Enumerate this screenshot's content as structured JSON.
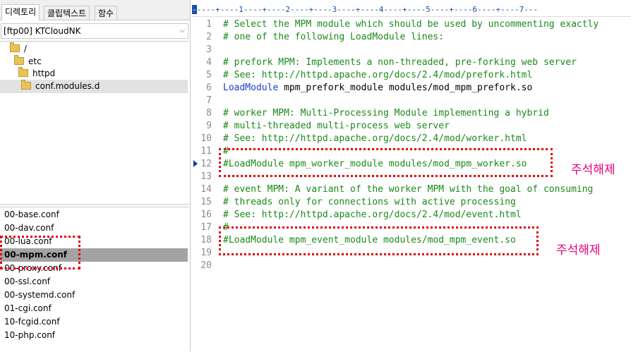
{
  "tabs": [
    "디렉토리",
    "클립텍스트",
    "함수"
  ],
  "site_select": "[ftp00] KTCloudNK",
  "tree": [
    "/",
    "etc",
    "httpd",
    "conf.modules.d"
  ],
  "files": [
    "00-base.conf",
    "00-dav.conf",
    "00-lua.conf",
    "00-mpm.conf",
    "00-proxy.conf",
    "00-ssl.conf",
    "00-systemd.conf",
    "01-cgi.conf",
    "10-fcgid.conf",
    "10-php.conf"
  ],
  "selected_file": "00-mpm.conf",
  "ruler_text": "----+----1----+----2----+----3----+----4----+----5----+----6----+----7---",
  "lines": [
    {
      "n": "1",
      "type": "comment",
      "text": "# Select the MPM module which should be used by uncommenting exactly"
    },
    {
      "n": "2",
      "type": "comment",
      "text": "# one of the following LoadModule lines:"
    },
    {
      "n": "3",
      "type": "blank",
      "text": ""
    },
    {
      "n": "4",
      "type": "comment",
      "text": "# prefork MPM: Implements a non-threaded, pre-forking web server"
    },
    {
      "n": "5",
      "type": "comment",
      "text": "# See: http://httpd.apache.org/docs/2.4/mod/prefork.html"
    },
    {
      "n": "6",
      "type": "directive",
      "kw": "LoadModule",
      "text": " mpm_prefork_module modules/mod_mpm_prefork.so"
    },
    {
      "n": "7",
      "type": "blank",
      "text": ""
    },
    {
      "n": "8",
      "type": "comment",
      "text": "# worker MPM: Multi-Processing Module implementing a hybrid"
    },
    {
      "n": "9",
      "type": "comment",
      "text": "# multi-threaded multi-process web server"
    },
    {
      "n": "10",
      "type": "comment",
      "text": "# See: http://httpd.apache.org/docs/2.4/mod/worker.html"
    },
    {
      "n": "11",
      "type": "comment",
      "text": "#"
    },
    {
      "n": "12",
      "type": "comment",
      "text": "#LoadModule mpm_worker_module modules/mod_mpm_worker.so"
    },
    {
      "n": "13",
      "type": "blank",
      "text": ""
    },
    {
      "n": "14",
      "type": "comment",
      "text": "# event MPM: A variant of the worker MPM with the goal of consuming"
    },
    {
      "n": "15",
      "type": "comment",
      "text": "# threads only for connections with active processing"
    },
    {
      "n": "16",
      "type": "comment",
      "text": "# See: http://httpd.apache.org/docs/2.4/mod/event.html"
    },
    {
      "n": "17",
      "type": "comment",
      "text": "#"
    },
    {
      "n": "18",
      "type": "comment",
      "text": "#LoadModule mpm_event_module modules/mod_mpm_event.so"
    },
    {
      "n": "19",
      "type": "blank",
      "text": ""
    },
    {
      "n": "20",
      "type": "blank",
      "text": ""
    }
  ],
  "annotations": [
    "주석해제",
    "주석해제"
  ],
  "colors": {
    "comment": "#1b8a1b",
    "keyword": "#1a3ad0",
    "annotation": "#e6007e",
    "highlight_box": "#e00000"
  }
}
